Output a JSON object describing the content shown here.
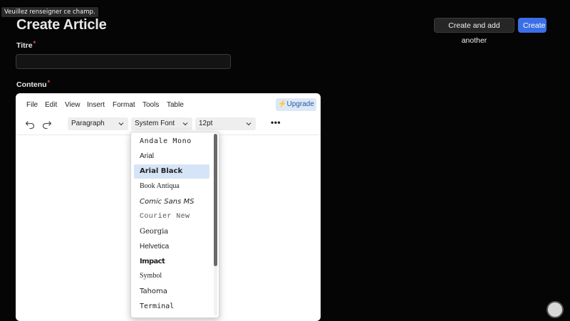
{
  "tooltip": "Veuillez renseigner ce champ.",
  "page": {
    "title": "Create Article",
    "create_another_label": "Create and add another",
    "create_label": "Create"
  },
  "form": {
    "titre_label": "Titre",
    "titre_value": "",
    "contenu_label": "Contenu",
    "required_mark": "*"
  },
  "editor": {
    "menu": [
      "File",
      "Edit",
      "View",
      "Insert",
      "Format",
      "Tools",
      "Table"
    ],
    "upgrade_label": "⚡Upgrade",
    "block_format": "Paragraph",
    "font_family": "System Font",
    "font_size": "12pt",
    "more_label": "•••",
    "icons": [
      "undo-icon",
      "redo-icon",
      "chevron-down-icon",
      "more-icon",
      "bolt-icon"
    ]
  },
  "font_dropdown": {
    "selected": "Arial Black",
    "options": [
      "Andale Mono",
      "Arial",
      "Arial Black",
      "Book Antiqua",
      "Comic Sans MS",
      "Courier New",
      "Georgia",
      "Helvetica",
      "Impact",
      "Symbol",
      "Tahoma",
      "Terminal"
    ]
  },
  "colors": {
    "background": "#050505",
    "primary": "#3b6fe6",
    "required": "#e25858",
    "selected_option": "#d6e4f7"
  }
}
